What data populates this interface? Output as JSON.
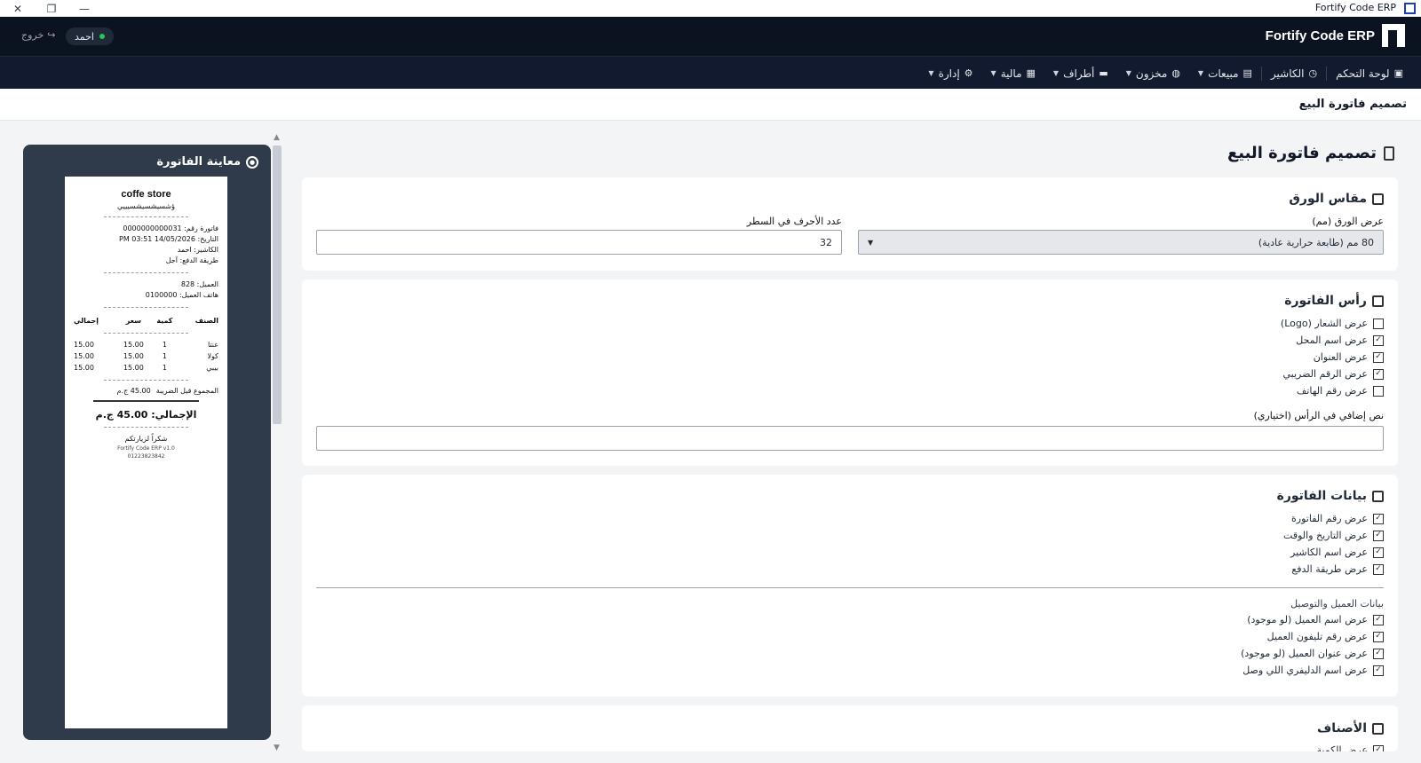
{
  "window": {
    "title": "Fortify Code ERP",
    "controls": [
      "✕",
      "❐",
      "—"
    ]
  },
  "header": {
    "brand": "Fortify Code ERP",
    "user": "احمد",
    "logout": "خروج"
  },
  "nav": [
    {
      "label": "لوحة التحكم",
      "icon": "dashboard-icon",
      "dropdown": false
    },
    {
      "label": "الكاشير",
      "icon": "cashier-icon",
      "dropdown": false
    },
    {
      "label": "مبيعات",
      "icon": "sales-icon",
      "dropdown": true
    },
    {
      "label": "مخزون",
      "icon": "inventory-icon",
      "dropdown": true
    },
    {
      "label": "أطراف",
      "icon": "parties-icon",
      "dropdown": true
    },
    {
      "label": "مالية",
      "icon": "finance-icon",
      "dropdown": true
    },
    {
      "label": "إدارة",
      "icon": "admin-icon",
      "dropdown": true
    }
  ],
  "page": {
    "title": "تصميم فاتورة البيع",
    "heading": "تصميم فاتورة البيع"
  },
  "preview": {
    "title": "معاينة الفاتورة",
    "store": "coffe store",
    "subtitle": "ؤشسيشسيشسيييي",
    "invoice_no": "فاتورة رقم: 0000000000031",
    "date": "التاريخ: 14/05/2026 PM 03:51",
    "cashier": "الكاشير: احمد",
    "payment": "طريقة الدفع: آجل",
    "customer": "العميل: 828",
    "customer_phone": "هاتف العميل: 0100000",
    "headers": [
      "الصنف",
      "كمية",
      "سعر",
      "إجمالي"
    ],
    "rows": [
      [
        "عنتا",
        "1",
        "15.00",
        "15.00"
      ],
      [
        "كولا",
        "1",
        "15.00",
        "15.00"
      ],
      [
        "بيبي",
        "1",
        "15.00",
        "15.00"
      ]
    ],
    "subtotal_label": "المجموع قبل الضريبة",
    "subtotal_value": "45.00 ج.م",
    "grand_total": "الإجمالي: 45.00 ج.م",
    "thanks": "شكراً لزيارتكم",
    "footer1": "Fortify Code ERP v1.0",
    "footer2": "01223823842"
  },
  "paper": {
    "title": "مقاس الورق",
    "width_label": "عرض الورق (مم)",
    "width_value": "80 مم (طابعة حرارية عادية)",
    "chars_label": "عدد الأحرف في السطر",
    "chars_value": "32"
  },
  "header_section": {
    "title": "رأس الفاتورة",
    "options": [
      {
        "label": "عرض الشعار (Logo)",
        "checked": false
      },
      {
        "label": "عرض اسم المحل",
        "checked": true
      },
      {
        "label": "عرض العنوان",
        "checked": true
      },
      {
        "label": "عرض الرقم الضريبي",
        "checked": true
      },
      {
        "label": "عرض رقم الهاتف",
        "checked": false
      }
    ],
    "extra_label": "نص إضافي في الرأس (اختياري)",
    "extra_value": ""
  },
  "invoice_data": {
    "title": "بيانات الفاتورة",
    "options": [
      {
        "label": "عرض رقم الفاتورة",
        "checked": true
      },
      {
        "label": "عرض التاريخ والوقت",
        "checked": true
      },
      {
        "label": "عرض اسم الكاشير",
        "checked": true
      },
      {
        "label": "عرض طريقة الدفع",
        "checked": true
      }
    ],
    "customer_title": "بيانات العميل والتوصيل",
    "customer_options": [
      {
        "label": "عرض اسم العميل (لو موجود)",
        "checked": true
      },
      {
        "label": "عرض رقم تليفون العميل",
        "checked": true
      },
      {
        "label": "عرض عنوان العميل (لو موجود)",
        "checked": true
      },
      {
        "label": "عرض اسم الدليفري اللي وصل",
        "checked": true
      }
    ]
  },
  "items_section": {
    "title": "الأصناف",
    "first_option": "عرض الكمية"
  },
  "colors": {
    "header_bg": "#0b1220",
    "nav_bg": "#111a2e",
    "preview_bg": "#2f3b4a",
    "status_online": "#22c55e"
  }
}
